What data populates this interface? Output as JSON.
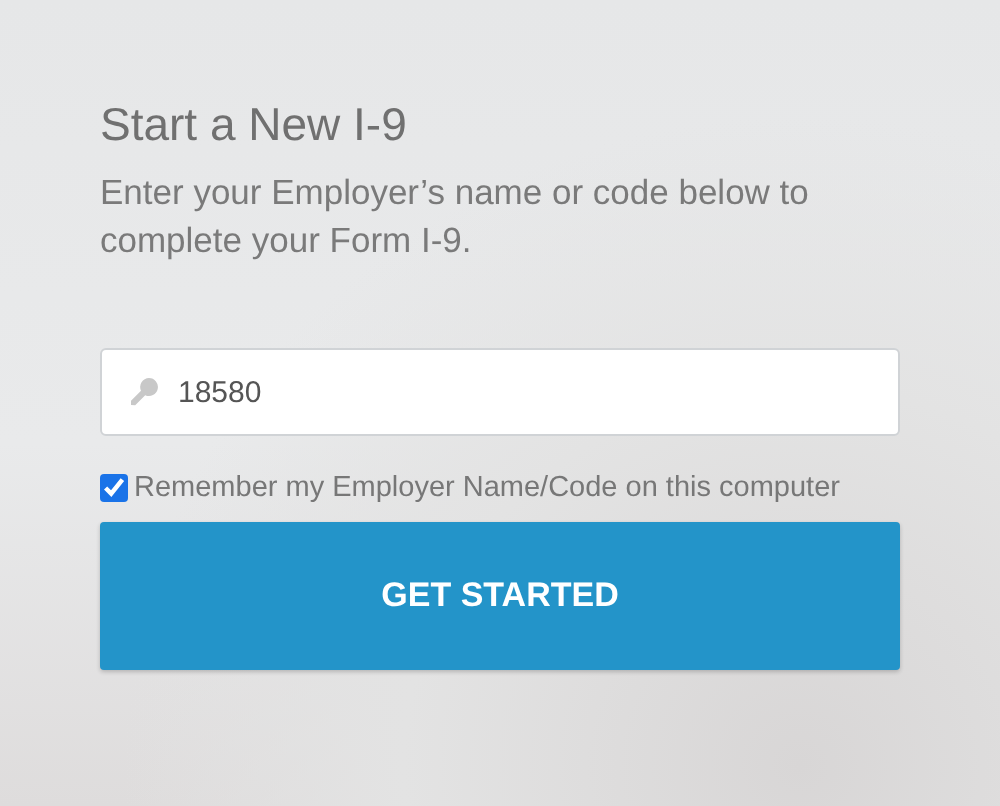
{
  "title": "Start a New I-9",
  "description": "Enter your Employer’s name or code below to complete your Form I-9.",
  "employer_field": {
    "value": "18580"
  },
  "remember": {
    "label": "Remember my Employer Name/Code on this computer",
    "checked": true
  },
  "button": "GET STARTED"
}
